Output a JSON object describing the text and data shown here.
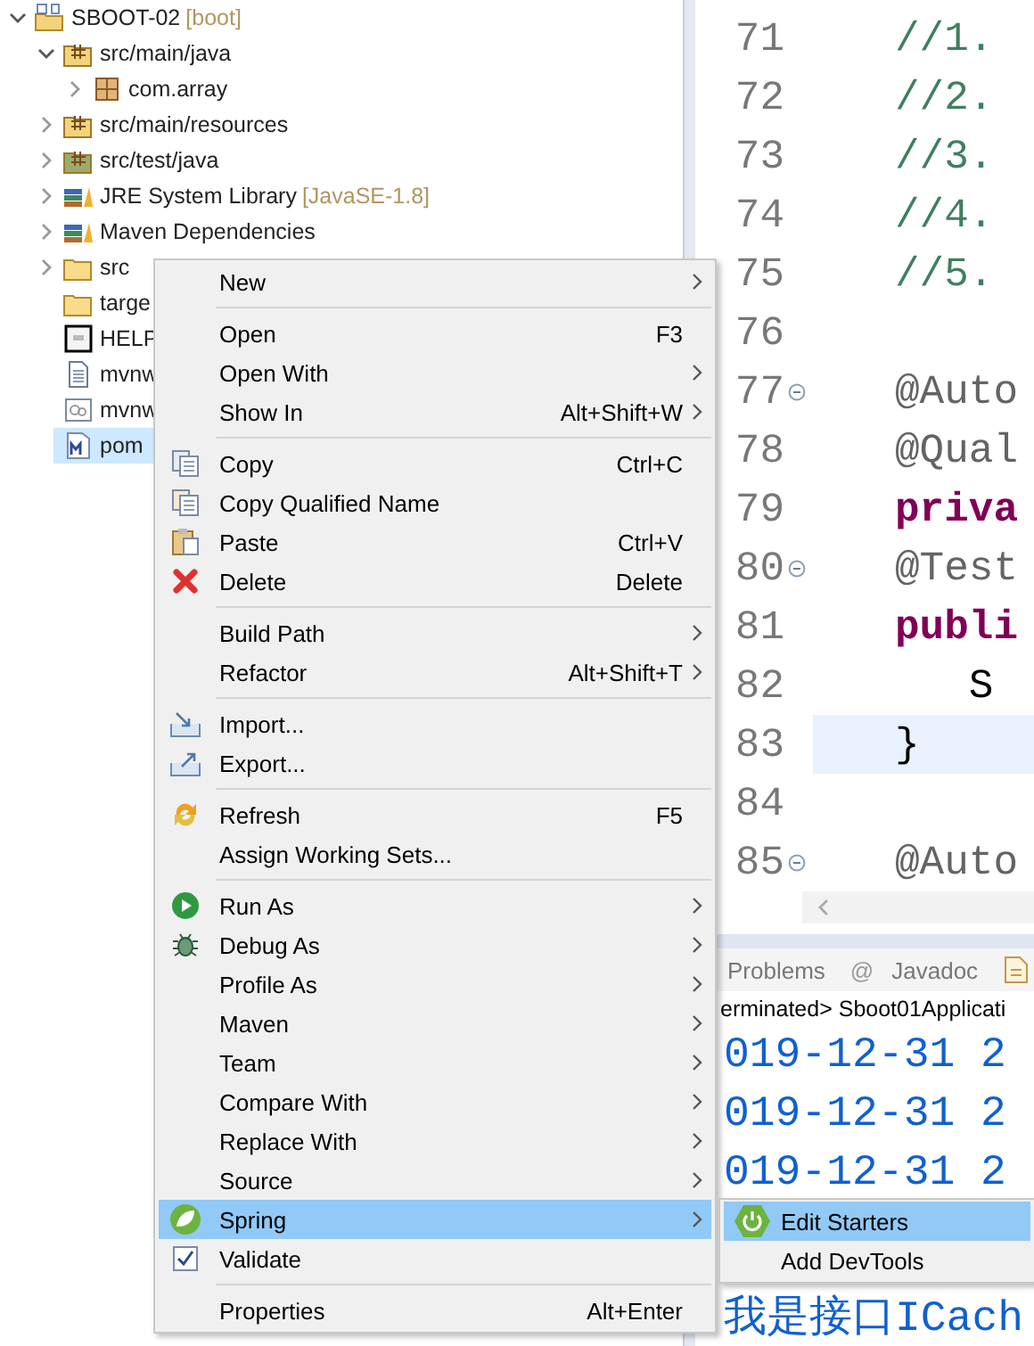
{
  "explorer": {
    "tree": [
      {
        "label": "SBOOT-02",
        "tag": "[boot]",
        "kind": "project",
        "expanded": true,
        "selected": false,
        "children": [
          {
            "label": "src/main/java",
            "kind": "source-folder",
            "expanded": true,
            "selected": false,
            "children": [
              {
                "label": "com.array",
                "kind": "package",
                "expanded": false,
                "selected": false
              }
            ]
          },
          {
            "label": "src/main/resources",
            "kind": "source-folder",
            "expanded": false,
            "selected": false
          },
          {
            "label": "src/test/java",
            "kind": "test-folder",
            "expanded": false,
            "selected": false
          },
          {
            "label": "JRE System Library",
            "tag": "[JavaSE-1.8]",
            "kind": "library",
            "expanded": false,
            "selected": false
          },
          {
            "label": "Maven Dependencies",
            "kind": "library",
            "expanded": false,
            "selected": false
          },
          {
            "label": "src",
            "kind": "folder",
            "expanded": false,
            "selected": false
          },
          {
            "label": "targe",
            "kind": "folder",
            "selected": false
          },
          {
            "label": "HELP",
            "kind": "help-file",
            "selected": false
          },
          {
            "label": "mvnw",
            "kind": "text-file",
            "selected": false
          },
          {
            "label": "mvnw",
            "kind": "script-file",
            "selected": false
          },
          {
            "label": "pom",
            "kind": "maven-file",
            "selected": true
          }
        ]
      }
    ]
  },
  "editor": {
    "lines": [
      {
        "number": "71",
        "text": "//1.",
        "kind": "comment",
        "fold": false,
        "current": false
      },
      {
        "number": "72",
        "text": "//2.",
        "kind": "comment",
        "fold": false,
        "current": false
      },
      {
        "number": "73",
        "text": "//3.",
        "kind": "comment",
        "fold": false,
        "current": false
      },
      {
        "number": "74",
        "text": "//4.",
        "kind": "comment",
        "fold": false,
        "current": false
      },
      {
        "number": "75",
        "text": "//5.",
        "kind": "comment",
        "fold": false,
        "current": false
      },
      {
        "number": "76",
        "fold": false,
        "current": false
      },
      {
        "number": "77",
        "text": "@Auto",
        "kind": "annotation",
        "fold": true,
        "current": false
      },
      {
        "number": "78",
        "text": "@Qual",
        "kind": "annotation",
        "fold": false,
        "current": false
      },
      {
        "number": "79",
        "text": "priva",
        "kind": "keyword",
        "fold": false,
        "current": false
      },
      {
        "number": "80",
        "text": "@Test",
        "kind": "annotation",
        "fold": true,
        "current": false
      },
      {
        "number": "81",
        "text": "publi",
        "kind": "keyword",
        "fold": false,
        "current": false
      },
      {
        "number": "82",
        "text": "   S",
        "kind": "plain",
        "fold": false,
        "current": false
      },
      {
        "number": "83",
        "text": "}",
        "kind": "plain",
        "fold": false,
        "current": true
      },
      {
        "number": "84",
        "fold": false,
        "current": false
      },
      {
        "number": "85",
        "text": "@Auto",
        "kind": "annotation",
        "fold": true,
        "current": false
      }
    ]
  },
  "console": {
    "tabs": [
      {
        "label": "Problems"
      },
      {
        "label": "Javadoc",
        "icon_char": "@"
      },
      {
        "kind": "doc"
      }
    ],
    "header": "erminated> Sboot01Applicati",
    "lines": [
      "019-12-31 2",
      "019-12-31 2",
      "019-12-31 2"
    ],
    "last_line": "我是接口ICach"
  },
  "context_menu": {
    "groups": [
      [
        {
          "label": "New",
          "submenu": true,
          "selected": false
        }
      ],
      [
        {
          "label": "Open",
          "shortcut": "F3",
          "submenu": false,
          "selected": false
        },
        {
          "label": "Open With",
          "submenu": true,
          "selected": false
        },
        {
          "label": "Show In",
          "shortcut": "Alt+Shift+W",
          "submenu": true,
          "selected": false
        }
      ],
      [
        {
          "label": "Copy",
          "shortcut": "Ctrl+C",
          "submenu": false,
          "kind": "copy",
          "selected": false
        },
        {
          "label": "Copy Qualified Name",
          "submenu": false,
          "kind": "copy-name",
          "selected": false
        },
        {
          "label": "Paste",
          "shortcut": "Ctrl+V",
          "submenu": false,
          "kind": "paste",
          "selected": false
        },
        {
          "label": "Delete",
          "shortcut": "Delete",
          "submenu": false,
          "kind": "delete",
          "selected": false
        }
      ],
      [
        {
          "label": "Build Path",
          "submenu": true,
          "selected": false
        },
        {
          "label": "Refactor",
          "shortcut": "Alt+Shift+T",
          "submenu": true,
          "selected": false
        }
      ],
      [
        {
          "label": "Import...",
          "submenu": false,
          "kind": "import",
          "selected": false
        },
        {
          "label": "Export...",
          "submenu": false,
          "kind": "export",
          "selected": false
        }
      ],
      [
        {
          "label": "Refresh",
          "shortcut": "F5",
          "submenu": false,
          "kind": "refresh",
          "selected": false
        },
        {
          "label": "Assign Working Sets...",
          "submenu": false,
          "selected": false
        }
      ],
      [
        {
          "label": "Run As",
          "submenu": true,
          "kind": "run",
          "selected": false
        },
        {
          "label": "Debug As",
          "submenu": true,
          "kind": "debug",
          "selected": false
        },
        {
          "label": "Profile As",
          "submenu": true,
          "selected": false
        },
        {
          "label": "Maven",
          "submenu": true,
          "selected": false
        },
        {
          "label": "Team",
          "submenu": true,
          "selected": false
        },
        {
          "label": "Compare With",
          "submenu": true,
          "selected": false
        },
        {
          "label": "Replace With",
          "submenu": true,
          "selected": false
        },
        {
          "label": "Source",
          "submenu": true,
          "selected": false
        },
        {
          "label": "Spring",
          "submenu": true,
          "kind": "spring",
          "selected": true
        },
        {
          "label": "Validate",
          "submenu": false,
          "kind": "validate",
          "selected": false
        }
      ],
      [
        {
          "label": "Properties",
          "shortcut": "Alt+Enter",
          "submenu": false,
          "selected": false
        }
      ]
    ]
  },
  "submenu": {
    "items": [
      {
        "label": "Edit Starters",
        "kind": "power",
        "selected": true
      },
      {
        "label": "Add DevTools",
        "selected": false
      }
    ]
  }
}
